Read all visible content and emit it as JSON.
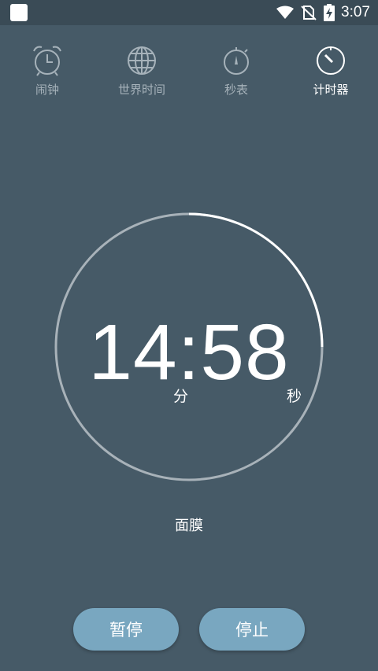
{
  "status_bar": {
    "time": "3:07"
  },
  "tabs": [
    {
      "label": "闹钟",
      "icon": "alarm-clock-icon",
      "active": false
    },
    {
      "label": "世界时间",
      "icon": "globe-icon",
      "active": false
    },
    {
      "label": "秒表",
      "icon": "stopwatch-icon",
      "active": false
    },
    {
      "label": "计时器",
      "icon": "timer-icon",
      "active": true
    }
  ],
  "timer": {
    "minutes": "14",
    "separator": ":",
    "seconds": "58",
    "minutes_unit": "分",
    "seconds_unit": "秒",
    "remaining_fraction": 0.75,
    "label": "面膜"
  },
  "buttons": {
    "pause": "暂停",
    "stop": "停止"
  },
  "colors": {
    "background": "#465a67",
    "button": "#79a7c0",
    "ring_track": "#a8b2b9",
    "ring_progress": "#ffffff"
  }
}
